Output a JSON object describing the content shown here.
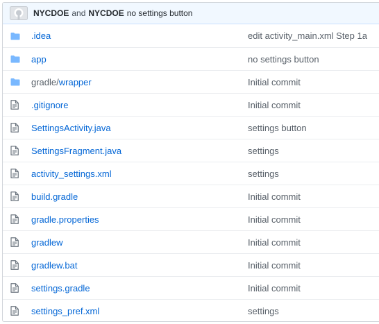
{
  "commit_bar": {
    "author": "NYCDOE",
    "join_word": "and",
    "committer": "NYCDOE",
    "message": "no settings button"
  },
  "colors": {
    "link": "#0366d6",
    "folder_icon": "#79b8ff",
    "file_icon": "#6a737d",
    "muted_text": "#586069",
    "commit_bar_bg": "#f1f8ff"
  },
  "entries": [
    {
      "type": "folder",
      "icon": "folder-icon",
      "prefix": "",
      "name": ".idea",
      "message": "edit activity_main.xml Step 1a"
    },
    {
      "type": "folder",
      "icon": "folder-icon",
      "prefix": "",
      "name": "app",
      "message": "no settings button"
    },
    {
      "type": "folder",
      "icon": "folder-icon",
      "prefix": "gradle/",
      "name": "wrapper",
      "message": "Initial commit"
    },
    {
      "type": "file",
      "icon": "file-icon",
      "prefix": "",
      "name": ".gitignore",
      "message": "Initial commit"
    },
    {
      "type": "file",
      "icon": "file-icon",
      "prefix": "",
      "name": "SettingsActivity.java",
      "message": "settings button"
    },
    {
      "type": "file",
      "icon": "file-icon",
      "prefix": "",
      "name": "SettingsFragment.java",
      "message": "settings"
    },
    {
      "type": "file",
      "icon": "file-icon",
      "prefix": "",
      "name": "activity_settings.xml",
      "message": "settings"
    },
    {
      "type": "file",
      "icon": "file-icon",
      "prefix": "",
      "name": "build.gradle",
      "message": "Initial commit"
    },
    {
      "type": "file",
      "icon": "file-icon",
      "prefix": "",
      "name": "gradle.properties",
      "message": "Initial commit"
    },
    {
      "type": "file",
      "icon": "file-icon",
      "prefix": "",
      "name": "gradlew",
      "message": "Initial commit"
    },
    {
      "type": "file",
      "icon": "file-icon",
      "prefix": "",
      "name": "gradlew.bat",
      "message": "Initial commit"
    },
    {
      "type": "file",
      "icon": "file-icon",
      "prefix": "",
      "name": "settings.gradle",
      "message": "Initial commit"
    },
    {
      "type": "file",
      "icon": "file-icon",
      "prefix": "",
      "name": "settings_pref.xml",
      "message": "settings"
    }
  ]
}
